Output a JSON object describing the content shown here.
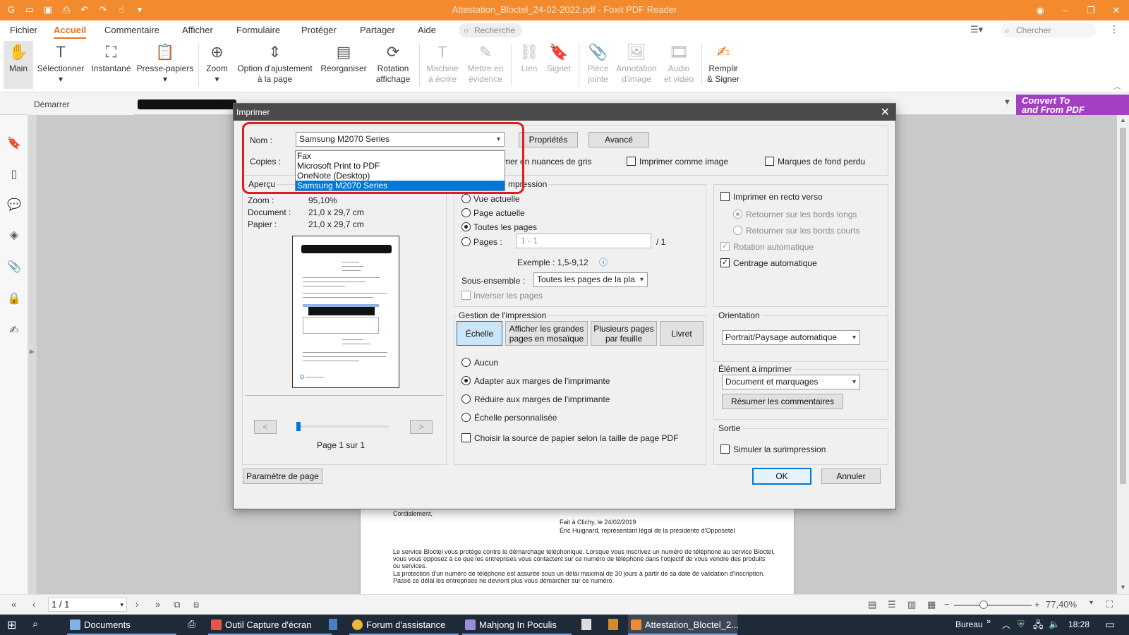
{
  "app": {
    "title": "Attestation_Bloctel_24-02-2022.pdf - Foxit PDF Reader",
    "accent": "#f28a2e"
  },
  "menu": {
    "items": [
      "Fichier",
      "Accueil",
      "Commentaire",
      "Afficher",
      "Formulaire",
      "Protéger",
      "Partager",
      "Aide"
    ],
    "active": "Accueil",
    "search_placeholder": "Recherche",
    "find_placeholder": "Chercher"
  },
  "ribbon": {
    "tools": [
      {
        "label": "Main",
        "icon": "hand-icon"
      },
      {
        "label": "Sélectionner",
        "icon": "select-text-icon"
      },
      {
        "label": "Instantané",
        "icon": "snapshot-icon"
      },
      {
        "label": "Presse-papiers",
        "icon": "clipboard-icon"
      },
      {
        "label": "Zoom",
        "icon": "zoom-icon"
      },
      {
        "label": "Option d'ajustement\nà la page",
        "icon": "fit-page-icon"
      },
      {
        "label": "Réorganiser",
        "icon": "reorganize-icon"
      },
      {
        "label": "Rotation\naffichage",
        "icon": "rotate-view-icon"
      },
      {
        "label": "Machine\nà écrire",
        "icon": "typewriter-icon"
      },
      {
        "label": "Mettre en\névidence",
        "icon": "highlight-icon"
      },
      {
        "label": "Lien",
        "icon": "link-icon"
      },
      {
        "label": "Signet",
        "icon": "bookmark-icon"
      },
      {
        "label": "Pièce\njointe",
        "icon": "attachment-icon"
      },
      {
        "label": "Annotation\nd'image",
        "icon": "image-annotation-icon"
      },
      {
        "label": "Audio\net vidéo",
        "icon": "audio-video-icon"
      },
      {
        "label": "Remplir\n& Signer",
        "icon": "fill-sign-icon"
      }
    ]
  },
  "tabs": {
    "start": "Démarrer"
  },
  "promo": {
    "line1": "Convert To",
    "line2": "and From PDF"
  },
  "document": {
    "lines": [
      "Cordialement,",
      "Fait à Clichy, le 24/02/2019",
      "Éric Huignard, représentant légal de la présidente d'Opposetel",
      "Le service Bloctel vous protège contre le démarchage téléphonique. Lorsque vous inscrivez un numéro de téléphone au service Bloctel,",
      "vous vous opposez à ce que les entreprises vous contactent sur ce numéro de téléphone dans l'objectif de vous vendre des produits",
      "ou services.",
      "La protection d'un numéro de téléphone est assurée sous un délai maximal de 30 jours à partir de sa date de validation d'inscription.",
      "Passé ce délai les entreprises ne devront plus vous démarcher sur ce numéro."
    ]
  },
  "statusbar": {
    "page": "1 / 1",
    "zoom": "77,40%",
    "zoom_level": 0.38
  },
  "dialog": {
    "title": "Imprimer",
    "printer": {
      "label": "Nom :",
      "selected": "Samsung M2070 Series",
      "options": [
        "Fax",
        "Microsoft Print to PDF",
        "OneNote (Desktop)",
        "Samsung M2070 Series"
      ]
    },
    "copies_label": "Copies :",
    "apercu_label": "Aperçu",
    "properties_btn": "Propriétés",
    "advanced_btn": "Avancé",
    "grayscale": "mer en nuances de gris",
    "print_as_image": "Imprimer comme image",
    "bleed_marks": "Marques de fond perdu",
    "zoom_row": "Zoom :",
    "zoom_value": "95,10%",
    "document_label": "Document :",
    "document_size": "21,0 x 29,7 cm",
    "paper_label": "Papier :",
    "paper_size": "21,0 x 29,7 cm",
    "prev_btn": "<",
    "next_btn": ">",
    "page_indicator": "Page 1 sur 1",
    "range": {
      "title": "mpression",
      "current_view": "Vue actuelle",
      "current_page": "Page actuelle",
      "all_pages": "Toutes les pages",
      "pages_label": "Pages :",
      "pages_value": "1 - 1",
      "pages_total": "/ 1",
      "example": "Exemple : 1,5-9,12",
      "subset_label": "Sous-ensemble :",
      "subset_value": "Toutes les pages de la pla",
      "reverse": "Inverser les pages"
    },
    "duplex": {
      "duplex": "Imprimer en recto verso",
      "long_edge": "Retourner sur les bords longs",
      "short_edge": "Retourner sur les bords courts",
      "auto_rotate": "Rotation automatique",
      "auto_center": "Centrage automatique"
    },
    "handling": {
      "title": "Gestion de l'impression",
      "scale_btn": "Échelle",
      "tile_btn_1": "Afficher les grandes",
      "tile_btn_2": "pages en mosaïque",
      "multi_btn_1": "Plusieurs pages",
      "multi_btn_2": "par feuille",
      "booklet_btn": "Livret",
      "none": "Aucun",
      "fit": "Adapter aux marges de l'imprimante",
      "shrink": "Réduire aux marges de l'imprimante",
      "custom": "Échelle personnalisée",
      "paper_source": "Choisir la source de papier selon la taille de page PDF"
    },
    "orientation": {
      "title": "Orientation",
      "value": "Portrait/Paysage automatique"
    },
    "element": {
      "title": "Élément à imprimer",
      "value": "Document et marquages",
      "summarize_btn": "Résumer les commentaires"
    },
    "output": {
      "title": "Sortie",
      "overprint": "Simuler la surimpression"
    },
    "page_setup_btn": "Paramètre de page",
    "ok_btn": "OK",
    "cancel_btn": "Annuler"
  },
  "taskbar": {
    "items": [
      "Documents",
      "Outil Capture d'écran",
      "Forum d'assistance in...",
      "Mahjong In Poculis",
      "Attestation_Bloctel_2..."
    ],
    "desktop": "Bureau",
    "time": "18:28"
  }
}
